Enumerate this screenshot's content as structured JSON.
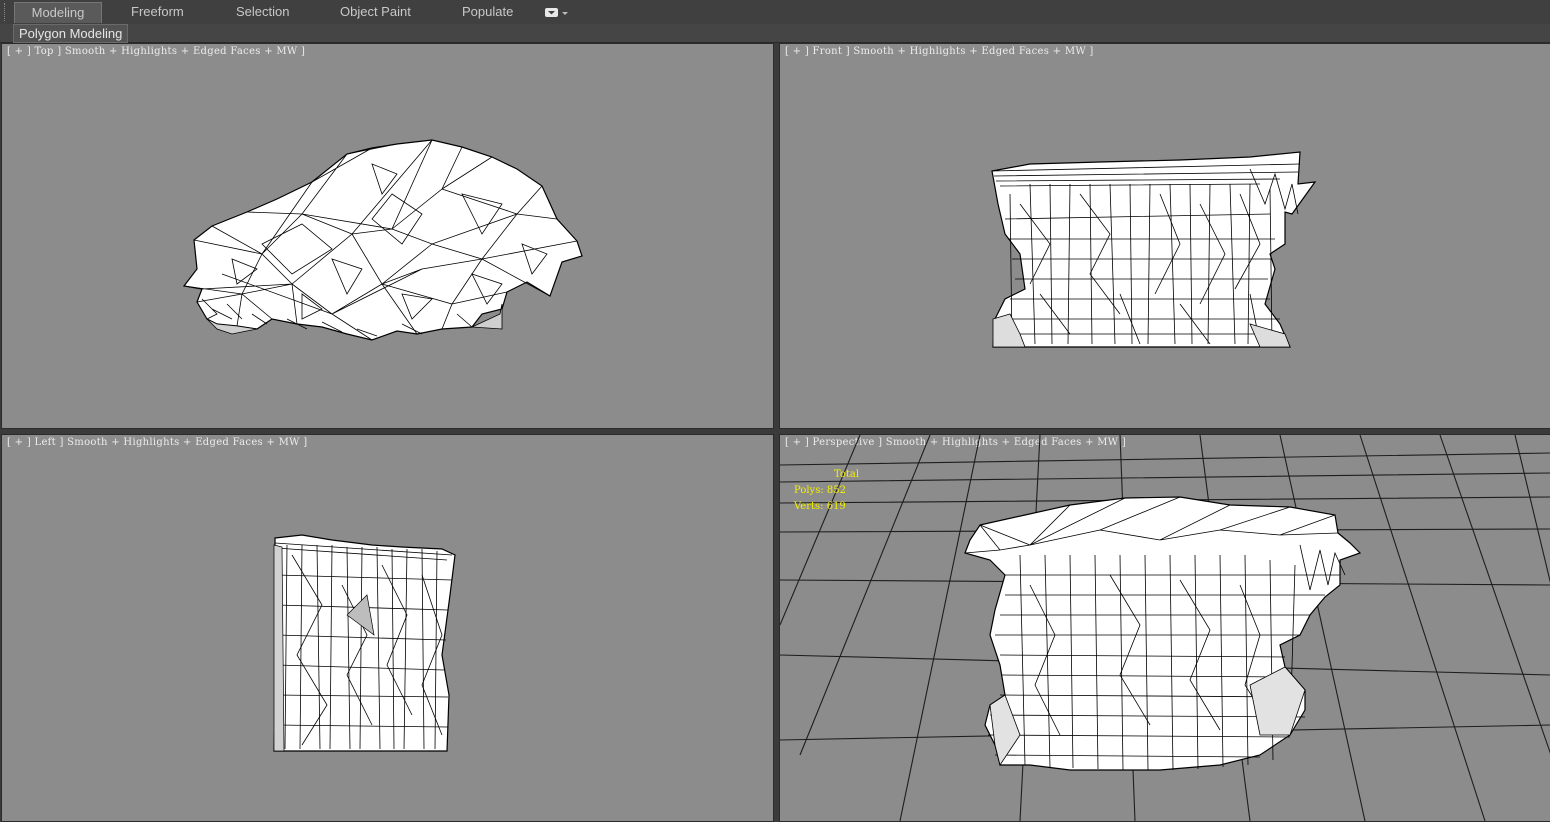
{
  "ribbon": {
    "tabs": [
      "Modeling",
      "Freeform",
      "Selection",
      "Object Paint",
      "Populate"
    ],
    "active_tab": "Modeling",
    "subpanel": "Polygon Modeling"
  },
  "viewports": {
    "top": {
      "label": "[ + ] Top ] Smooth + Highlights + Edged Faces + MW ]"
    },
    "front": {
      "label": "[ + ] Front ] Smooth + Highlights + Edged Faces + MW ]"
    },
    "left": {
      "label": "[ + ] Left ] Smooth + Highlights + Edged Faces + MW ]"
    },
    "perspective": {
      "label": "[ + ] Perspective ] Smooth + Highlights + Edged Faces + MW ]"
    }
  },
  "stats": {
    "header": "Total",
    "polys": "Polys: 852",
    "verts": "Verts: 619"
  },
  "colors": {
    "viewport_bg": "#8c8c8c",
    "mesh_fill": "#ffffff",
    "mesh_edge": "#000000",
    "stats_text": "#f4f000",
    "grid_line": "#1e1e1e"
  }
}
